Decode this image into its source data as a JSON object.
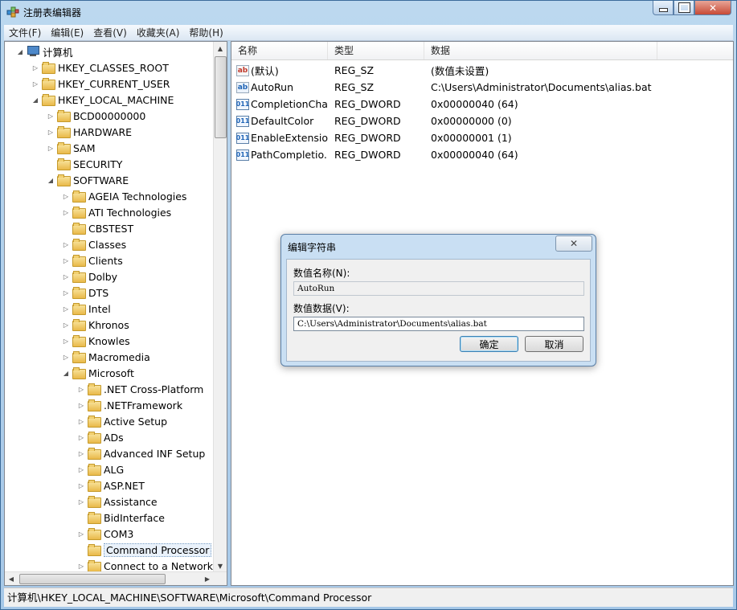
{
  "window": {
    "title": "注册表编辑器"
  },
  "menu": [
    "文件(F)",
    "编辑(E)",
    "查看(V)",
    "收藏夹(A)",
    "帮助(H)"
  ],
  "tree": [
    {
      "label": "计算机",
      "level": 0,
      "exp": "open",
      "icon": "computer"
    },
    {
      "label": "HKEY_CLASSES_ROOT",
      "level": 1,
      "exp": "closed"
    },
    {
      "label": "HKEY_CURRENT_USER",
      "level": 1,
      "exp": "closed"
    },
    {
      "label": "HKEY_LOCAL_MACHINE",
      "level": 1,
      "exp": "open"
    },
    {
      "label": "BCD00000000",
      "level": 2,
      "exp": "closed"
    },
    {
      "label": "HARDWARE",
      "level": 2,
      "exp": "closed"
    },
    {
      "label": "SAM",
      "level": 2,
      "exp": "closed"
    },
    {
      "label": "SECURITY",
      "level": 2,
      "exp": "none"
    },
    {
      "label": "SOFTWARE",
      "level": 2,
      "exp": "open"
    },
    {
      "label": "AGEIA Technologies",
      "level": 3,
      "exp": "closed"
    },
    {
      "label": "ATI Technologies",
      "level": 3,
      "exp": "closed"
    },
    {
      "label": "CBSTEST",
      "level": 3,
      "exp": "none"
    },
    {
      "label": "Classes",
      "level": 3,
      "exp": "closed"
    },
    {
      "label": "Clients",
      "level": 3,
      "exp": "closed"
    },
    {
      "label": "Dolby",
      "level": 3,
      "exp": "closed"
    },
    {
      "label": "DTS",
      "level": 3,
      "exp": "closed"
    },
    {
      "label": "Intel",
      "level": 3,
      "exp": "closed"
    },
    {
      "label": "Khronos",
      "level": 3,
      "exp": "closed"
    },
    {
      "label": "Knowles",
      "level": 3,
      "exp": "closed"
    },
    {
      "label": "Macromedia",
      "level": 3,
      "exp": "closed"
    },
    {
      "label": "Microsoft",
      "level": 3,
      "exp": "open"
    },
    {
      "label": ".NET Cross-Platform",
      "level": 4,
      "exp": "closed"
    },
    {
      "label": ".NETFramework",
      "level": 4,
      "exp": "closed"
    },
    {
      "label": "Active Setup",
      "level": 4,
      "exp": "closed"
    },
    {
      "label": "ADs",
      "level": 4,
      "exp": "closed"
    },
    {
      "label": "Advanced INF Setup",
      "level": 4,
      "exp": "closed"
    },
    {
      "label": "ALG",
      "level": 4,
      "exp": "closed"
    },
    {
      "label": "ASP.NET",
      "level": 4,
      "exp": "closed"
    },
    {
      "label": "Assistance",
      "level": 4,
      "exp": "closed"
    },
    {
      "label": "BidInterface",
      "level": 4,
      "exp": "none"
    },
    {
      "label": "COM3",
      "level": 4,
      "exp": "closed"
    },
    {
      "label": "Command Processor",
      "level": 4,
      "exp": "none",
      "selected": true
    },
    {
      "label": "Connect to a Network P",
      "level": 4,
      "exp": "closed"
    }
  ],
  "list": {
    "columns": [
      "名称",
      "类型",
      "数据"
    ],
    "rows": [
      {
        "name": "(默认)",
        "type": "REG_SZ",
        "data": "(数值未设置)",
        "icon": "string"
      },
      {
        "name": "AutoRun",
        "type": "REG_SZ",
        "data": "C:\\Users\\Administrator\\Documents\\alias.bat",
        "icon": "string-blue"
      },
      {
        "name": "CompletionChar",
        "type": "REG_DWORD",
        "data": "0x00000040 (64)",
        "icon": "dword"
      },
      {
        "name": "DefaultColor",
        "type": "REG_DWORD",
        "data": "0x00000000 (0)",
        "icon": "dword"
      },
      {
        "name": "EnableExtensio...",
        "type": "REG_DWORD",
        "data": "0x00000001 (1)",
        "icon": "dword"
      },
      {
        "name": "PathCompletio...",
        "type": "REG_DWORD",
        "data": "0x00000040 (64)",
        "icon": "dword"
      }
    ]
  },
  "icons": {
    "string": "ab",
    "dword": "011",
    "expand_open": "◢",
    "expand_closed": "▷",
    "close": "✕"
  },
  "status": "计算机\\HKEY_LOCAL_MACHINE\\SOFTWARE\\Microsoft\\Command Processor",
  "dialog": {
    "title": "编辑字符串",
    "name_label": "数值名称(N):",
    "name_value": "AutoRun",
    "data_label": "数值数据(V):",
    "data_value": "C:\\Users\\Administrator\\Documents\\alias.bat",
    "ok": "确定",
    "cancel": "取消"
  }
}
